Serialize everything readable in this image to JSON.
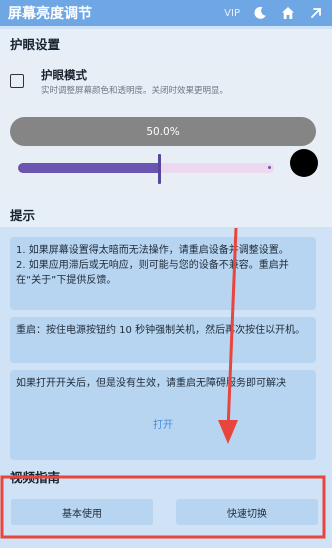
{
  "header": {
    "title": "屏幕亮度调节",
    "vip_label": "VIP",
    "icons": [
      "moon-icon",
      "home-icon",
      "external-link-icon"
    ],
    "background": "#6fa6e4"
  },
  "eye_protection": {
    "section_title": "护眼设置",
    "mode_title": "护眼模式",
    "mode_desc": "实时调整屏幕颜色和透明度。关闭时效果更明显。",
    "checked": false,
    "opacity_label": "50.0%",
    "slider_value_fraction": 0.55,
    "color": "#000000",
    "slider_fill_color": "#6a55b0"
  },
  "tips": {
    "section_title": "提示",
    "cards": [
      {
        "lines": [
          "1. 如果屏幕设置得太暗而无法操作，请重启设备并调整设置。",
          "2. 如果应用滞后或无响应，则可能与您的设备不兼容。重启并在“关于”下提供反馈。"
        ]
      },
      {
        "lines": [
          "重启：按住电源按钮约 10 秒钟强制关机，然后再次按住以开机。"
        ]
      },
      {
        "lines": [
          "如果打开开关后，但是没有生效，请重启无障碍服务即可解决"
        ],
        "link": "打开"
      }
    ]
  },
  "video_guide": {
    "section_title": "视频指南",
    "buttons": [
      "基本使用",
      "快速切换"
    ]
  },
  "annotation_color": "#e8453c"
}
